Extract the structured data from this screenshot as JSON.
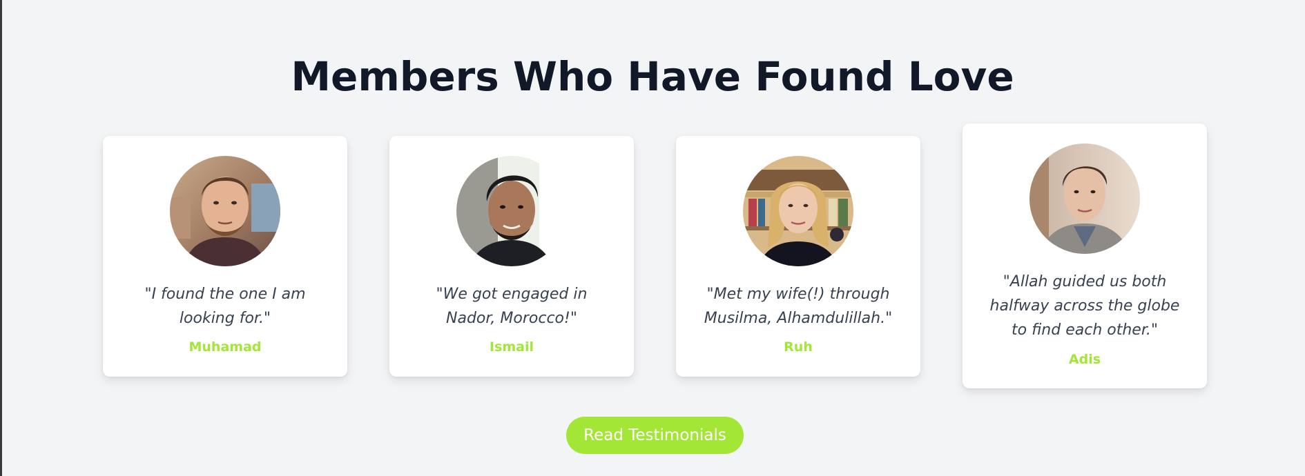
{
  "section": {
    "title": "Members Who Have Found Love"
  },
  "testimonials": [
    {
      "quote": "\"I found the one I am looking for.\"",
      "name": "Muhamad",
      "avatar": "man-with-beard-portrait"
    },
    {
      "quote": "\"We got engaged in Nador, Morocco!\"",
      "name": "Ismail",
      "avatar": "man-with-dark-hair-portrait"
    },
    {
      "quote": "\"Met my wife(!) through Musilma, Alhamdulillah.\"",
      "name": "Ruh",
      "avatar": "woman-with-blonde-hair-portrait"
    },
    {
      "quote": "\"Allah guided us both halfway across the globe to find each other.\"",
      "name": "Adis",
      "avatar": "man-in-blazer-portrait"
    }
  ],
  "cta": {
    "label": "Read Testimonials"
  },
  "colors": {
    "accent": "#a3e635",
    "background": "#f3f4f6",
    "heading": "#111827",
    "quote": "#374151"
  }
}
